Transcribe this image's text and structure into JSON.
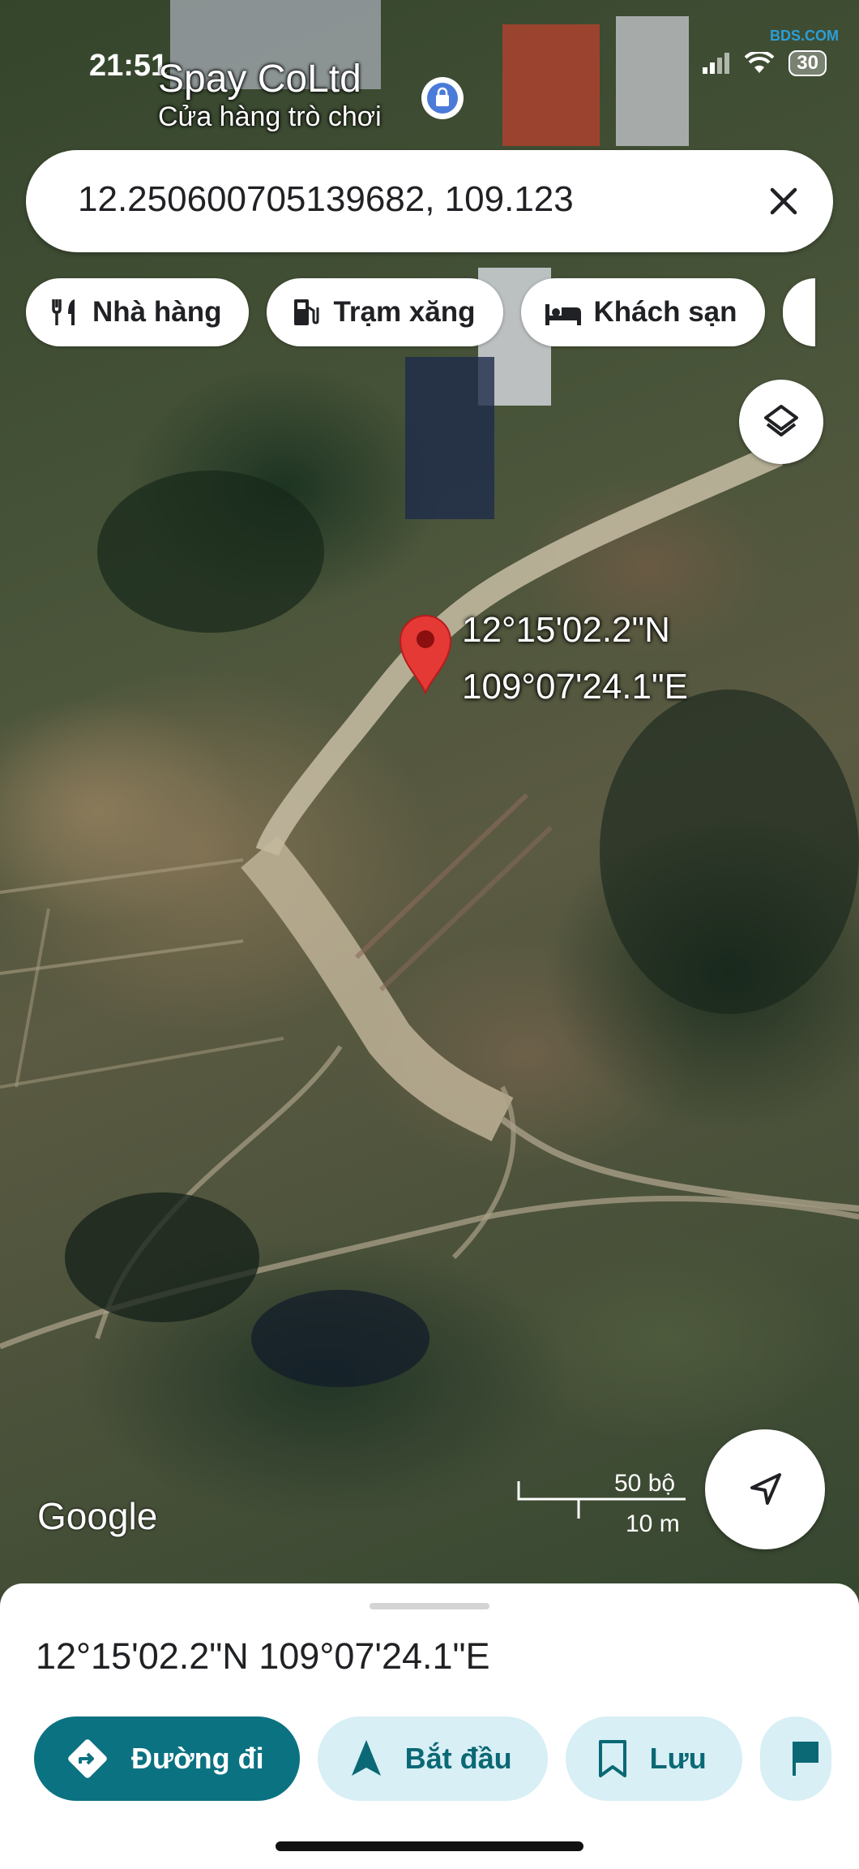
{
  "status": {
    "time": "21:51",
    "battery": "30"
  },
  "watermark": "BDS.COM",
  "map": {
    "poi_name": "Spay CoLtd",
    "poi_subtitle": "Cửa hàng trò chơi",
    "pin_lat": "12°15'02.2\"N",
    "pin_lng": "109°07'24.1\"E",
    "attribution": "Google",
    "scale_ft": "50 bộ",
    "scale_m": "10 m"
  },
  "search": {
    "value": "12.250600705139682, 109.123"
  },
  "chips": [
    {
      "label": "Nhà hàng",
      "icon": "restaurant-icon"
    },
    {
      "label": "Trạm xăng",
      "icon": "gas-station-icon"
    },
    {
      "label": "Khách sạn",
      "icon": "hotel-icon"
    }
  ],
  "sheet": {
    "title": "12°15'02.2\"N 109°07'24.1\"E",
    "actions": [
      {
        "label": "Đường đi",
        "icon": "directions-icon"
      },
      {
        "label": "Bắt đầu",
        "icon": "navigation-arrow-icon"
      },
      {
        "label": "Lưu",
        "icon": "bookmark-icon"
      }
    ]
  },
  "colors": {
    "primary": "#0b7281",
    "secondary": "#d7eff5",
    "pin": "#e53935"
  }
}
